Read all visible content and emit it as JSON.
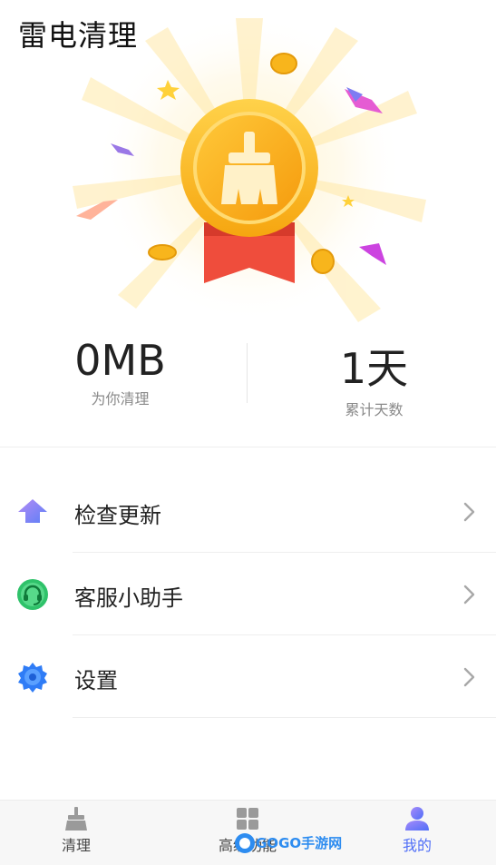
{
  "app": {
    "title": "雷电清理"
  },
  "stats": [
    {
      "value": "0MB",
      "label": "为你清理"
    },
    {
      "value": "1天",
      "label": "累计天数"
    }
  ],
  "menu": [
    {
      "label": "检查更新",
      "icon": "arrow-up-icon"
    },
    {
      "label": "客服小助手",
      "icon": "headset-icon"
    },
    {
      "label": "设置",
      "icon": "gear-icon"
    }
  ],
  "tabs": [
    {
      "label": "清理",
      "icon": "broom-icon",
      "active": false
    },
    {
      "label": "高级功能",
      "icon": "grid-icon",
      "active": false
    },
    {
      "label": "我的",
      "icon": "user-icon",
      "active": true
    }
  ],
  "watermark": {
    "text": "GOGO手游网"
  },
  "colors": {
    "accent": "#4f6ef7",
    "medal": "#f8b51c",
    "ribbon": "#ef4d3c"
  }
}
